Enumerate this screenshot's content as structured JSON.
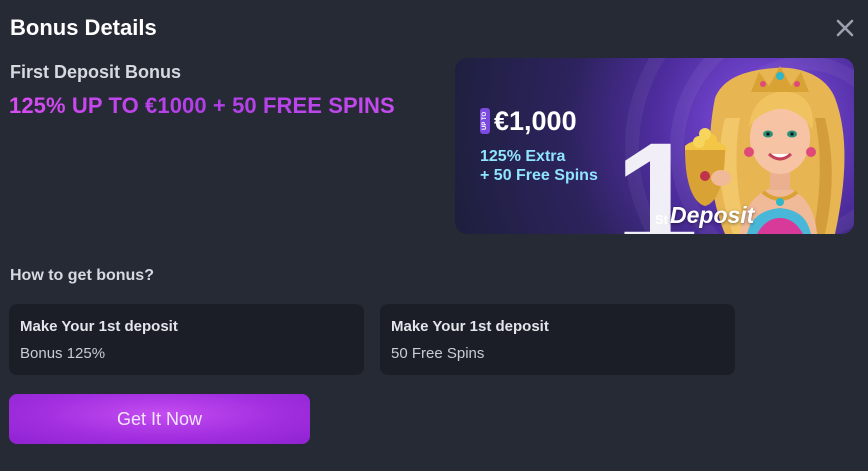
{
  "modal": {
    "title": "Bonus Details",
    "close_icon": "close-icon"
  },
  "bonus": {
    "name": "First Deposit Bonus",
    "offer": "125% UP TO €1000 + 50 FREE SPINS"
  },
  "banner": {
    "up_to": "UP TO",
    "amount": "€1,000",
    "extra_line1": "125% Extra",
    "extra_line2": "+ 50 Free Spins",
    "big_number": "1",
    "ordinal": "St",
    "deposit_word": "Deposit"
  },
  "howto": {
    "title": "How to get bonus?",
    "steps": [
      {
        "title": "Make Your 1st deposit",
        "value": "Bonus 125%"
      },
      {
        "title": "Make Your 1st deposit",
        "value": "50 Free Spins"
      }
    ]
  },
  "cta": {
    "label": "Get It Now"
  },
  "colors": {
    "background": "#262a35",
    "card": "#1b1e27",
    "accent_purple": "#b03ee8",
    "banner_cyan": "#8fe4ff"
  }
}
